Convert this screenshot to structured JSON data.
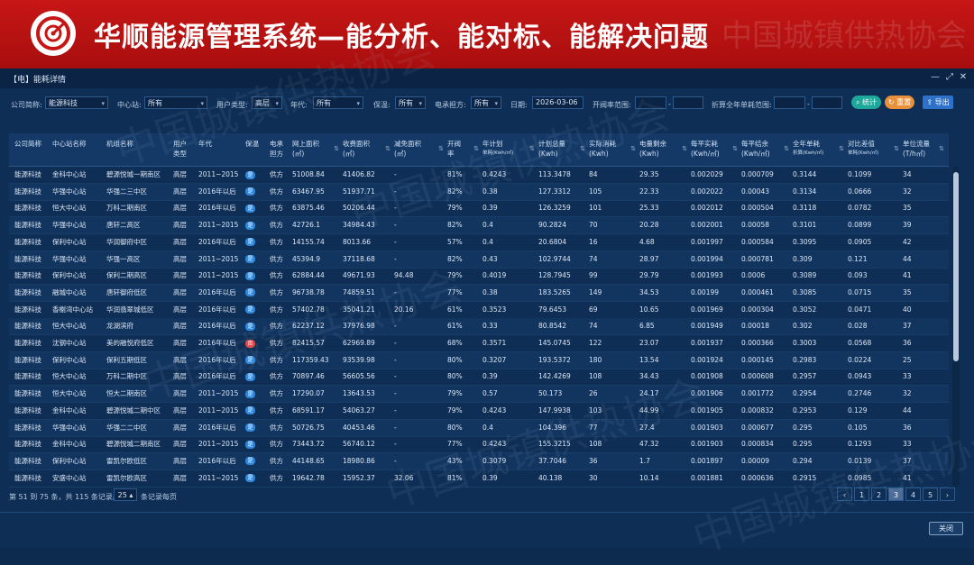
{
  "banner": {
    "title": "华顺能源管理系统—能分析、能对标、能解决问题",
    "watermark": "中国城镇供热协会"
  },
  "window": {
    "title": "【电】能耗详情",
    "controls": [
      "—",
      "⤢",
      "✕"
    ]
  },
  "filters": {
    "company_label": "公司简称:",
    "company_value": "能源科技",
    "center_label": "中心站:",
    "center_value": "所有",
    "usertype_label": "用户类型:",
    "usertype_value": "高层",
    "year_label": "年代:",
    "year_value": "所有",
    "warm_label": "保温:",
    "warm_value": "所有",
    "power_label": "电承担方:",
    "power_value": "所有",
    "date_label": "日期:",
    "date_value": "2026-03-06",
    "rate_label": "开阀率范围:",
    "rate_sep": "-",
    "convert_label": "折算全年单耗范围:",
    "convert_sep": "-",
    "stats_btn": "统计",
    "reset_btn": "重置",
    "export_btn": "导出"
  },
  "columns": [
    {
      "l1": "公司简称",
      "l2": ""
    },
    {
      "l1": "中心站名称",
      "l2": ""
    },
    {
      "l1": "机组名称",
      "l2": ""
    },
    {
      "l1": "用户",
      "l2": "类型"
    },
    {
      "l1": "年代",
      "l2": ""
    },
    {
      "l1": "保温",
      "l2": ""
    },
    {
      "l1": "电承",
      "l2": "担方"
    },
    {
      "l1": "网上面积",
      "l2": "(㎡)"
    },
    {
      "l1": "收费面积",
      "l2": "(㎡)"
    },
    {
      "l1": "减免面积",
      "l2": "(㎡)"
    },
    {
      "l1": "开阀",
      "l2": "率"
    },
    {
      "l1": "年计划",
      "l2": "单耗(Kwh/㎡)"
    },
    {
      "l1": "计划总量",
      "l2": "(Kwh)"
    },
    {
      "l1": "实际消耗",
      "l2": "(Kwh)"
    },
    {
      "l1": "电量剩余",
      "l2": "(Kwh)"
    },
    {
      "l1": "每平实耗",
      "l2": "(Kwh/㎡)"
    },
    {
      "l1": "每平结余",
      "l2": "(Kwh/㎡)"
    },
    {
      "l1": "全年单耗",
      "l2": "折算(Kwh/㎡)"
    },
    {
      "l1": "对比差值",
      "l2": "单耗(Kwh/㎡)"
    },
    {
      "l1": "单位流量",
      "l2": "(T/h㎡)"
    }
  ],
  "rows": [
    [
      "能源科技",
      "金科中心站",
      "碧源悦城一期南区",
      "高层",
      "2011~2015",
      "是",
      "供方",
      "51008.84",
      "41406.82",
      "-",
      "81%",
      "0.4243",
      "113.3478",
      "84",
      "29.35",
      "0.002029",
      "0.000709",
      "0.3144",
      "0.1099",
      "34"
    ],
    [
      "能源科技",
      "华强中心站",
      "华强二三中区",
      "高层",
      "2016年以后",
      "是",
      "供方",
      "63467.95",
      "51937.71",
      "-",
      "82%",
      "0.38",
      "127.3312",
      "105",
      "22.33",
      "0.002022",
      "0.00043",
      "0.3134",
      "0.0666",
      "32"
    ],
    [
      "能源科技",
      "恒大中心站",
      "万科二期南区",
      "高层",
      "2016年以后",
      "是",
      "供方",
      "63875.46",
      "50206.44",
      "-",
      "79%",
      "0.39",
      "126.3259",
      "101",
      "25.33",
      "0.002012",
      "0.000504",
      "0.3118",
      "0.0782",
      "35"
    ],
    [
      "能源科技",
      "华强中心站",
      "唐轩二高区",
      "高层",
      "2011~2015",
      "是",
      "供方",
      "42726.1",
      "34984.43",
      "-",
      "82%",
      "0.4",
      "90.2824",
      "70",
      "20.28",
      "0.002001",
      "0.00058",
      "0.3101",
      "0.0899",
      "39"
    ],
    [
      "能源科技",
      "保利中心站",
      "华润御府中区",
      "高层",
      "2016年以后",
      "是",
      "供方",
      "14155.74",
      "8013.66",
      "-",
      "57%",
      "0.4",
      "20.6804",
      "16",
      "4.68",
      "0.001997",
      "0.000584",
      "0.3095",
      "0.0905",
      "42"
    ],
    [
      "能源科技",
      "华强中心站",
      "华强一高区",
      "高层",
      "2011~2015",
      "是",
      "供方",
      "45394.9",
      "37118.68",
      "-",
      "82%",
      "0.43",
      "102.9744",
      "74",
      "28.97",
      "0.001994",
      "0.000781",
      "0.309",
      "0.121",
      "44"
    ],
    [
      "能源科技",
      "保利中心站",
      "保利二期高区",
      "高层",
      "2011~2015",
      "是",
      "供方",
      "62884.44",
      "49671.93",
      "94.48",
      "79%",
      "0.4019",
      "128.7945",
      "99",
      "29.79",
      "0.001993",
      "0.0006",
      "0.3089",
      "0.093",
      "41"
    ],
    [
      "能源科技",
      "融城中心站",
      "唐轩御府低区",
      "高层",
      "2016年以后",
      "是",
      "供方",
      "96738.78",
      "74859.51",
      "-",
      "77%",
      "0.38",
      "183.5265",
      "149",
      "34.53",
      "0.00199",
      "0.000461",
      "0.3085",
      "0.0715",
      "35"
    ],
    [
      "能源科技",
      "香榭湾中心站",
      "华润翡翠城低区",
      "高层",
      "2016年以后",
      "是",
      "供方",
      "57402.78",
      "35041.21",
      "20.16",
      "61%",
      "0.3523",
      "79.6453",
      "69",
      "10.65",
      "0.001969",
      "0.000304",
      "0.3052",
      "0.0471",
      "40"
    ],
    [
      "能源科技",
      "恒大中心站",
      "龙湖滨府",
      "高层",
      "2016年以后",
      "是",
      "供方",
      "62237.12",
      "37976.98",
      "-",
      "61%",
      "0.33",
      "80.8542",
      "74",
      "6.85",
      "0.001949",
      "0.00018",
      "0.302",
      "0.028",
      "37"
    ],
    [
      "能源科技",
      "沈钢中心站",
      "美的融悦府低区",
      "高层",
      "2016年以后",
      "否",
      "供方",
      "82415.57",
      "62969.89",
      "-",
      "68%",
      "0.3571",
      "145.0745",
      "122",
      "23.07",
      "0.001937",
      "0.000366",
      "0.3003",
      "0.0568",
      "36"
    ],
    [
      "能源科技",
      "保利中心站",
      "保利五期低区",
      "高层",
      "2016年以后",
      "是",
      "供方",
      "117359.43",
      "93539.98",
      "-",
      "80%",
      "0.3207",
      "193.5372",
      "180",
      "13.54",
      "0.001924",
      "0.000145",
      "0.2983",
      "0.0224",
      "25"
    ],
    [
      "能源科技",
      "恒大中心站",
      "万科二期中区",
      "高层",
      "2016年以后",
      "是",
      "供方",
      "70897.46",
      "56605.56",
      "-",
      "80%",
      "0.39",
      "142.4269",
      "108",
      "34.43",
      "0.001908",
      "0.000608",
      "0.2957",
      "0.0943",
      "33"
    ],
    [
      "能源科技",
      "恒大中心站",
      "恒大二期南区",
      "高层",
      "2011~2015",
      "是",
      "供方",
      "17290.07",
      "13643.53",
      "-",
      "79%",
      "0.57",
      "50.173",
      "26",
      "24.17",
      "0.001906",
      "0.001772",
      "0.2954",
      "0.2746",
      "32"
    ],
    [
      "能源科技",
      "金科中心站",
      "碧源悦城二期中区",
      "高层",
      "2011~2015",
      "是",
      "供方",
      "68591.17",
      "54063.27",
      "-",
      "79%",
      "0.4243",
      "147.9938",
      "103",
      "44.99",
      "0.001905",
      "0.000832",
      "0.2953",
      "0.129",
      "44"
    ],
    [
      "能源科技",
      "华强中心站",
      "华强二二中区",
      "高层",
      "2016年以后",
      "是",
      "供方",
      "50726.75",
      "40453.46",
      "-",
      "80%",
      "0.4",
      "104.396",
      "77",
      "27.4",
      "0.001903",
      "0.000677",
      "0.295",
      "0.105",
      "36"
    ],
    [
      "能源科技",
      "金科中心站",
      "碧源悦城二期南区",
      "高层",
      "2011~2015",
      "是",
      "供方",
      "73443.72",
      "56740.12",
      "-",
      "77%",
      "0.4243",
      "155.3215",
      "108",
      "47.32",
      "0.001903",
      "0.000834",
      "0.295",
      "0.1293",
      "33"
    ],
    [
      "能源科技",
      "保利中心站",
      "雷凯尔欧低区",
      "高层",
      "2016年以后",
      "是",
      "供方",
      "44148.65",
      "18980.86",
      "-",
      "43%",
      "0.3079",
      "37.7046",
      "36",
      "1.7",
      "0.001897",
      "0.00009",
      "0.294",
      "0.0139",
      "37"
    ],
    [
      "能源科技",
      "安盛中心站",
      "雷凯尔欧高区",
      "高层",
      "2011~2015",
      "是",
      "供方",
      "19642.78",
      "15952.37",
      "32.06",
      "81%",
      "0.39",
      "40.138",
      "30",
      "10.14",
      "0.001881",
      "0.000636",
      "0.2915",
      "0.0985",
      "41"
    ]
  ],
  "footer": {
    "info_prefix": "第 51 到 75 条，共 115 条记录。",
    "page_size": "25",
    "info_suffix": "条记录每页",
    "pages": [
      "‹",
      "1",
      "2",
      "3",
      "4",
      "5",
      "›"
    ],
    "active_page": "3"
  },
  "close_btn": "关闭",
  "colors": {
    "banner": "#b81212",
    "bg": "#0f2e55",
    "accent": "#2f86d8",
    "stats": "#1fa79a",
    "reset": "#e8903a",
    "export": "#2d72c8"
  }
}
